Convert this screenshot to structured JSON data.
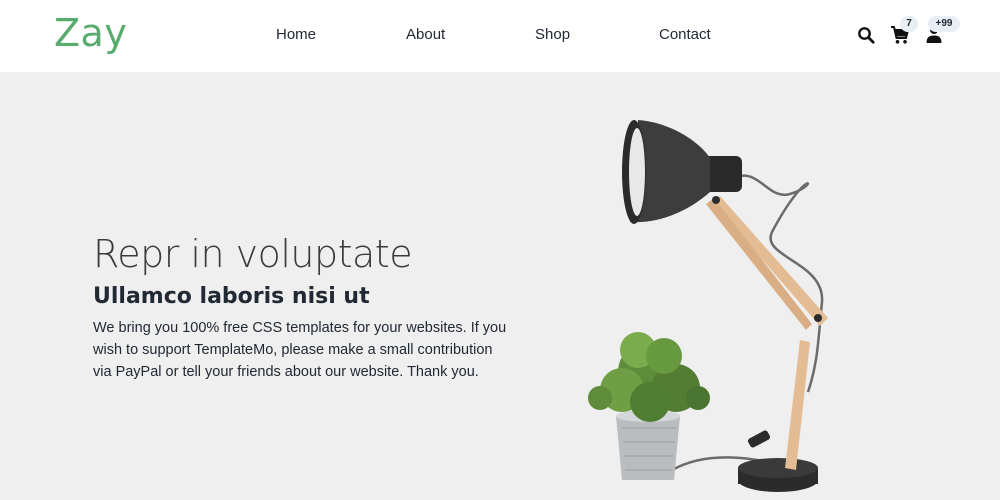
{
  "brand": {
    "logo": "Zay",
    "accent_color": "#59ab6e"
  },
  "nav": {
    "items": [
      {
        "label": "Home"
      },
      {
        "label": "About"
      },
      {
        "label": "Shop"
      },
      {
        "label": "Contact"
      }
    ]
  },
  "header_icons": {
    "search": {
      "icon": "search-icon"
    },
    "cart": {
      "icon": "cart-icon",
      "badge": "7"
    },
    "user": {
      "icon": "user-icon",
      "badge": "+99"
    }
  },
  "hero": {
    "title": "Repr in voluptate",
    "subtitle": "Ullamco laboris nisi ut",
    "text": "We bring you 100% free CSS templates for your websites. If you wish to support TemplateMo, please make a small contribution via PayPal or tell your friends about our website. Thank you.",
    "image": "desk-lamp-and-potted-plant"
  }
}
